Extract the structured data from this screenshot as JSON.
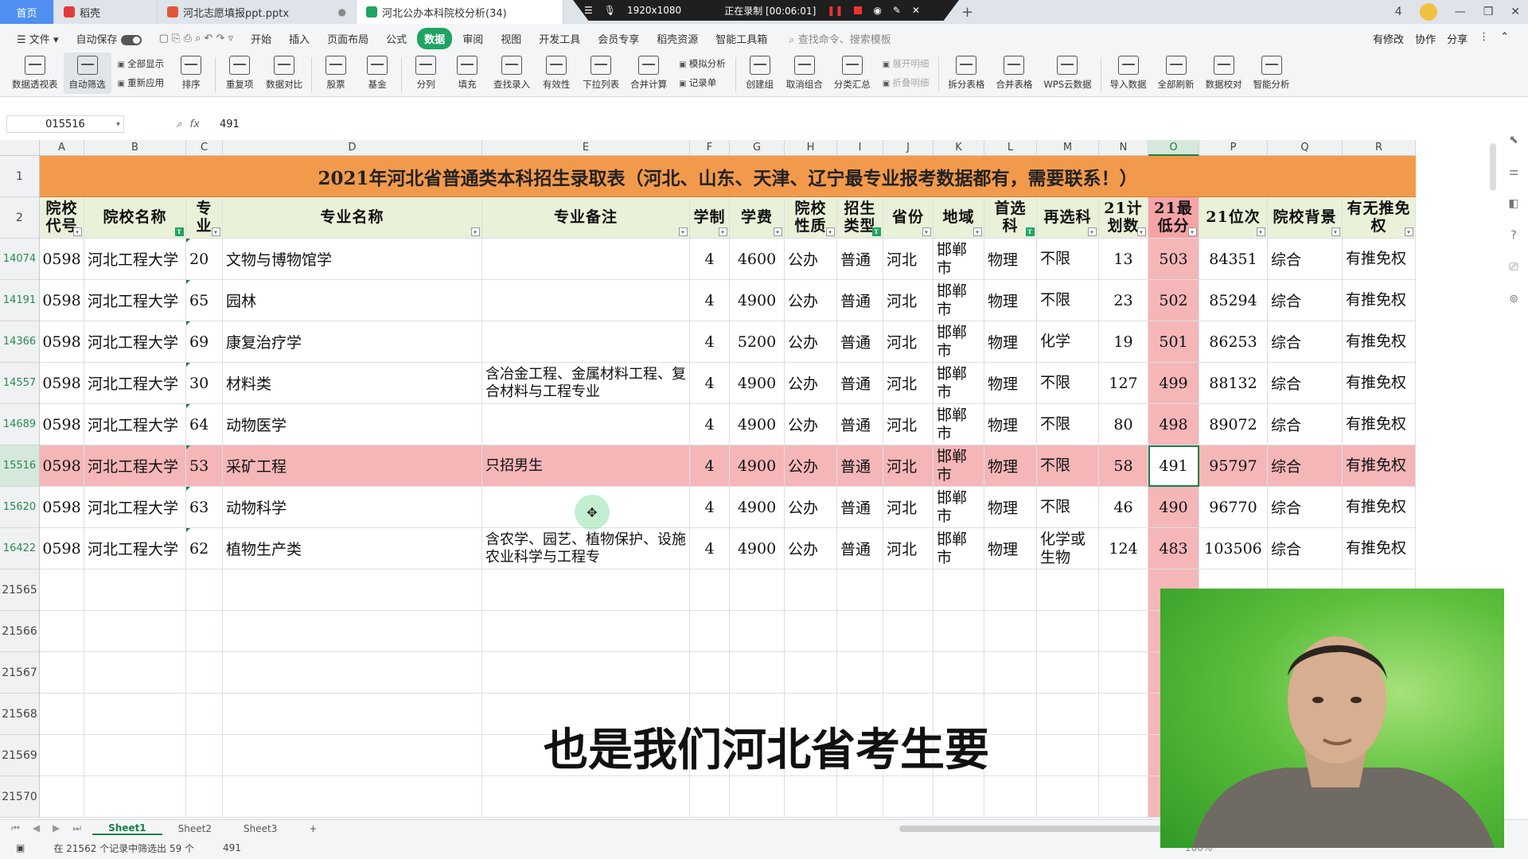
{
  "titlebar": {
    "tabs": [
      {
        "label": "首页",
        "type": "home"
      },
      {
        "label": "稻壳",
        "icon": "wps-logo-icon",
        "color": "#e23b3b"
      },
      {
        "label": "河北志愿填报ppt.pptx",
        "icon": "ppt-icon",
        "color": "#e0583a"
      },
      {
        "label": "河北公办本科院校分析(34)",
        "icon": "sheet-icon",
        "color": "#1fa463"
      }
    ],
    "recording": {
      "resolution": "1920x1080",
      "status": "正在录制 [00:06:01]"
    },
    "window_buttons": [
      "4",
      "—",
      "❐",
      "✕"
    ]
  },
  "menu": {
    "file": "文件",
    "autosave": "自动保存",
    "items": [
      "开始",
      "插入",
      "页面布局",
      "公式",
      "数据",
      "审阅",
      "视图",
      "开发工具",
      "会员专享",
      "稻壳资源",
      "智能工具箱"
    ],
    "active": "数据",
    "search_placeholder": "查找命令、搜索模板",
    "right": [
      "有修改",
      "协作",
      "分享"
    ]
  },
  "ribbon": {
    "buttons": [
      "数据透视表",
      "自动筛选",
      "排序",
      "重复项",
      "数据对比",
      "股票",
      "基金",
      "分列",
      "填充",
      "查找录入",
      "有效性",
      "下拉列表",
      "合并计算",
      "创建组",
      "取消组合",
      "分类汇总",
      "拆分表格",
      "合并表格",
      "WPS云数据",
      "导入数据",
      "全部刷新",
      "数据校对",
      "智能分析"
    ],
    "stack1": [
      "全部显示",
      "重新应用"
    ],
    "stack2": [
      "模拟分析",
      "记录单"
    ],
    "stack3": [
      "展开明细",
      "折叠明细"
    ]
  },
  "formula_bar": {
    "name_box": "015516",
    "fx": "fx",
    "value": "491"
  },
  "sheet": {
    "columns": [
      "A",
      "B",
      "C",
      "D",
      "E",
      "F",
      "G",
      "H",
      "I",
      "J",
      "K",
      "L",
      "M",
      "N",
      "O",
      "P",
      "Q",
      "R"
    ],
    "title": "2021年河北省普通类本科招生录取表（河北、山东、天津、辽宁最专业报考数据都有，需要联系！）",
    "headers": [
      "院校代号",
      "院校名称",
      "专业",
      "专业名称",
      "专业备注",
      "学制",
      "学费",
      "院校性质",
      "招生类型",
      "省份",
      "地域",
      "首选科",
      "再选科",
      "21计划数",
      "21最低分",
      "21位次",
      "院校背景",
      "有无推免权"
    ],
    "header_row_num": "2",
    "title_row_num": "1",
    "rows": [
      {
        "n": "14074",
        "cells": [
          "0598",
          "河北工程大学",
          "20",
          "文物与博物馆学",
          "",
          "4",
          "4600",
          "公办",
          "普通",
          "河北",
          "邯郸市",
          "物理",
          "不限",
          "13",
          "503",
          "84351",
          "综合",
          "有推免权"
        ]
      },
      {
        "n": "14191",
        "cells": [
          "0598",
          "河北工程大学",
          "65",
          "园林",
          "",
          "4",
          "4900",
          "公办",
          "普通",
          "河北",
          "邯郸市",
          "物理",
          "不限",
          "23",
          "502",
          "85294",
          "综合",
          "有推免权"
        ]
      },
      {
        "n": "14366",
        "cells": [
          "0598",
          "河北工程大学",
          "69",
          "康复治疗学",
          "",
          "4",
          "5200",
          "公办",
          "普通",
          "河北",
          "邯郸市",
          "物理",
          "化学",
          "19",
          "501",
          "86253",
          "综合",
          "有推免权"
        ]
      },
      {
        "n": "14557",
        "cells": [
          "0598",
          "河北工程大学",
          "30",
          "材料类",
          "含冶金工程、金属材料工程、复合材料与工程专业",
          "4",
          "4900",
          "公办",
          "普通",
          "河北",
          "邯郸市",
          "物理",
          "不限",
          "127",
          "499",
          "88132",
          "综合",
          "有推免权"
        ]
      },
      {
        "n": "14689",
        "cells": [
          "0598",
          "河北工程大学",
          "64",
          "动物医学",
          "",
          "4",
          "4900",
          "公办",
          "普通",
          "河北",
          "邯郸市",
          "物理",
          "不限",
          "80",
          "498",
          "89072",
          "综合",
          "有推免权"
        ]
      },
      {
        "n": "15516",
        "cells": [
          "0598",
          "河北工程大学",
          "53",
          "采矿工程",
          "只招男生",
          "4",
          "4900",
          "公办",
          "普通",
          "河北",
          "邯郸市",
          "物理",
          "不限",
          "58",
          "491",
          "95797",
          "综合",
          "有推免权"
        ],
        "selected": true
      },
      {
        "n": "15620",
        "cells": [
          "0598",
          "河北工程大学",
          "63",
          "动物科学",
          "",
          "4",
          "4900",
          "公办",
          "普通",
          "河北",
          "邯郸市",
          "物理",
          "不限",
          "46",
          "490",
          "96770",
          "综合",
          "有推免权"
        ]
      },
      {
        "n": "16422",
        "cells": [
          "0598",
          "河北工程大学",
          "62",
          "植物生产类",
          "含农学、园艺、植物保护、设施农业科学与工程专",
          "4",
          "4900",
          "公办",
          "普通",
          "河北",
          "邯郸市",
          "物理",
          "化学或生物",
          "124",
          "483",
          "103506",
          "综合",
          "有推免权"
        ]
      }
    ],
    "empty_rows": [
      "21565",
      "21566",
      "21567",
      "21568",
      "21569",
      "21570"
    ]
  },
  "subtitle": "也是我们河北省考生要",
  "sheet_tabs": [
    "Sheet1",
    "Sheet2",
    "Sheet3"
  ],
  "status": {
    "filter_info": "在 21562 个记录中筛选出 59 个",
    "value": "491",
    "zoom": "100%"
  },
  "colors": {
    "title_bg": "#f29a4c",
    "header_bg": "#e9f1d8",
    "highlight": "#f5b6b8",
    "accent": "#1a7f45"
  }
}
